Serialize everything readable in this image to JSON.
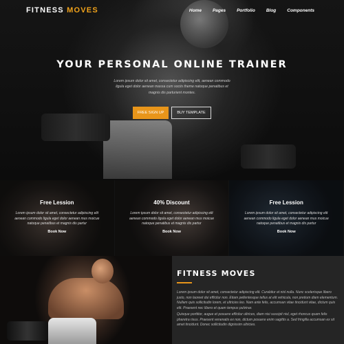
{
  "nav": {
    "brand_part1": "FITNESS",
    "brand_part2": "MOVES",
    "items": [
      "Home",
      "Pages",
      "Portfolio",
      "Blog",
      "Components"
    ]
  },
  "hero": {
    "title": "YOUR PERSONAL ONLINE TRAINER",
    "text": "Lorem ipsum dolor sit amet, consectetur adipiscing elit, aenean commodo ligula eget dolor aenean massa cum sociis theme natoque penatibus et magnis dis parturient montes.",
    "primary_button": "FREE SIGN UP",
    "secondary_button": "BUY TEMPLATE"
  },
  "panels": [
    {
      "title": "Free Lession",
      "text": "Lorem ipsum dolor sit amet, consectetur adipiscing elit aenean commodo ligula eget dolor aenean mus moicue natoque penatibus et magnis dis partur",
      "link": "Book Now"
    },
    {
      "title": "40% Discount",
      "text": "Lorem ipsum dolor sit amet, consectetur adipiscing elit aenean commodo ligula eget dolor aenean mus moicue natoque penatibus et magnis dis partur",
      "link": "Book Now"
    },
    {
      "title": "Free Lession",
      "text": "Lorem ipsum dolor sit amet, consectetur adipiscing elit aenean commodo ligula eget dolor aenean mus moicue natoque penatibus et magnis dis partur",
      "link": "Book Now"
    }
  ],
  "about": {
    "title": "FITNESS MOVES",
    "paragraph1": "Lorem ipsum dolor sit amet, consectetur adipiscing elit. Curabitur et nisl nulla. Nunc scelerisque libero justo, non laoreet dui efficitur non. Etiam pellentesque tellus at elit vehicula, non pretium diam elementum. Nullam quis sollicitudin lorem, et ultricies leo. Nam ante felis, accumsan vitae tincidunt vitae, dictum quis elit. Praesent nec libero et quam tempus pulvinar.",
    "paragraph2": "Quisque porttitor, augue et posuere efficitur ultrices, diam nisi suscipit nisl, eget rhoncus quam felis pharetra risus. Praesent venenatis ex non, dictum posuere enim sagittis a. Sed fringilla accumsan ex sit amet tincidunt. Donec sollicitudin dignissim ultricies."
  },
  "colors": {
    "accent": "#e8951a",
    "dark_bg": "#252525"
  }
}
